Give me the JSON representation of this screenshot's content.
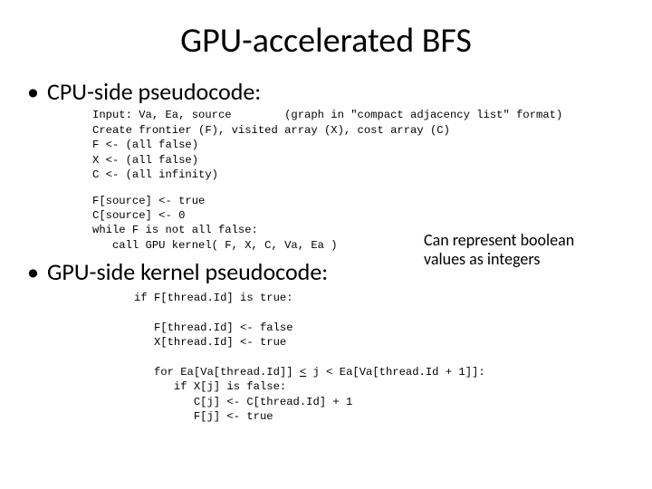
{
  "title": "GPU-accelerated BFS",
  "bullet1": "CPU-side pseudocode:",
  "code_cpu_block1": "Input: Va, Ea, source        (graph in \"compact adjacency list\" format)\nCreate frontier (F), visited array (X), cost array (C)\nF <- (all false)\nX <- (all false)\nC <- (all infinity)",
  "code_cpu_block2": "F[source] <- true\nC[source] <- 0\nwhile F is not all false:\n   call GPU kernel( F, X, C, Va, Ea )",
  "note": "Can represent boolean values as integers",
  "bullet2": "GPU-side kernel pseudocode:",
  "gpu_line1": "if F[thread.Id] is true:",
  "gpu_line2": "   F[thread.Id] <- false",
  "gpu_line3": "   X[thread.Id] <- true",
  "gpu_loop_pre": "   for Ea[Va[thread.Id]] ",
  "gpu_loop_lt": "<",
  "gpu_loop_mid": " j ",
  "gpu_loop_lt2": "<",
  "gpu_loop_post": " Ea[Va[thread.Id + 1]]:",
  "gpu_line5": "      if X[j] is false:",
  "gpu_line6": "         C[j] <- C[thread.Id] + 1",
  "gpu_line7": "         F[j] <- true"
}
